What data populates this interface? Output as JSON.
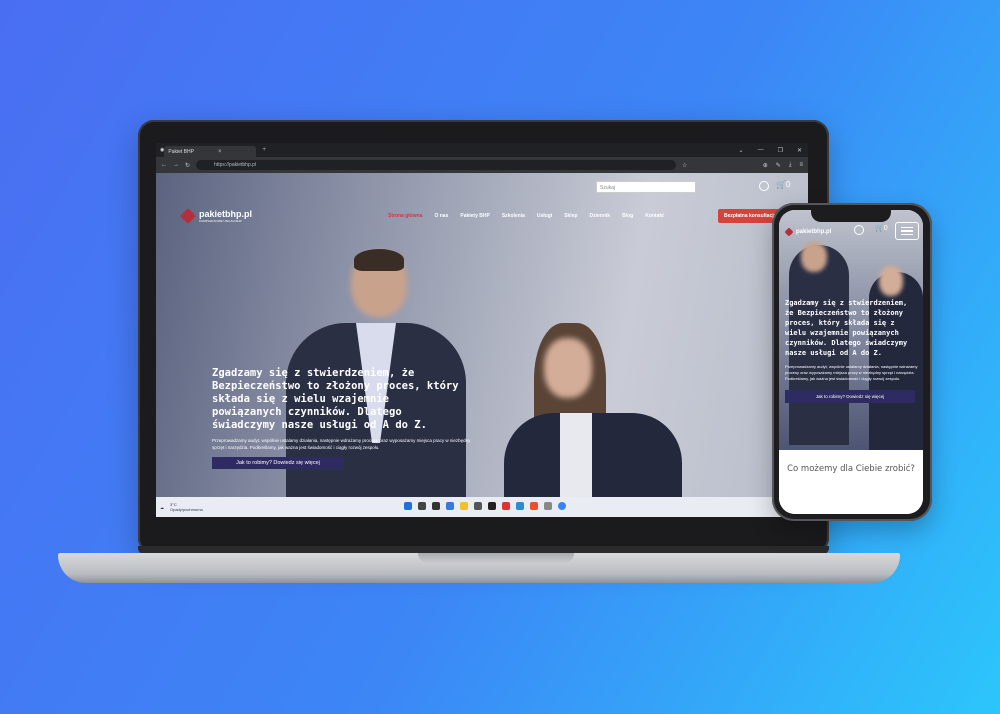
{
  "browser": {
    "tab_title": "Pakiet BHP",
    "tab_close": "×",
    "new_tab": "+",
    "url": "https://pakietbhp.pl",
    "window_controls": [
      "⌄",
      "—",
      "❐",
      "✕"
    ]
  },
  "site": {
    "search_placeholder": "Szukaj",
    "cart_count": "0",
    "logo": "pakietbhp.pl",
    "logo_tagline": "KOMPLEKSOWE USŁUGI BHP",
    "nav": [
      "Strona główna",
      "O nas",
      "Pakiety BHP",
      "Szkolenia",
      "Usługi",
      "Sklep",
      "Dziennik",
      "Blog",
      "Kontakt"
    ],
    "cta": "Bezpłatna konsultacja",
    "hero_title": "Zgadzamy się z stwierdzeniem, że Bezpieczeństwo to złożony proces, który składa się z wielu wzajemnie powiązanych czynników. Dlatego świadczymy nasze usługi od A do Z.",
    "hero_desc": "Przeprowadzamy audyt, wspólnie ustalamy działania, następnie wdrażamy procesy oraz wyposażamy miejsca pracy w niezbędny sprzęt i narzędzia. Podkreślamy, jak ważna jest świadomość i ciągły rozwój zespołu.",
    "hero_button": "Jak to robimy? Dowiedz się więcej"
  },
  "taskbar": {
    "temp": "3°C",
    "weather": "Opady/pochmurno"
  },
  "phone": {
    "logo": "pakietbhp.pl",
    "cart_count": "0",
    "hero_title": "Zgadzamy się z stwierdzeniem, że Bezpieczeństwo to złożony proces, który składa się z wielu wzajemnie powiązanych czynników. Dlatego świadczymy nasze usługi od A do Z.",
    "hero_desc": "Przeprowadzamy audyt, wspólnie ustalamy działania, następnie wdrażamy procesy oraz wyposażamy miejsca pracy w niezbędny sprzęt i narzędzia. Podkreślamy, jak ważna jest świadomość i ciągły rozwój zespołu.",
    "hero_button": "Jak to robimy? Dowiedz się więcej",
    "section_title": "Co możemy dla Ciebie zrobić?"
  },
  "colors": {
    "accent_red": "#d5443c",
    "button_navy": "#2e2b62",
    "background_blue": "#4a6ef2"
  }
}
